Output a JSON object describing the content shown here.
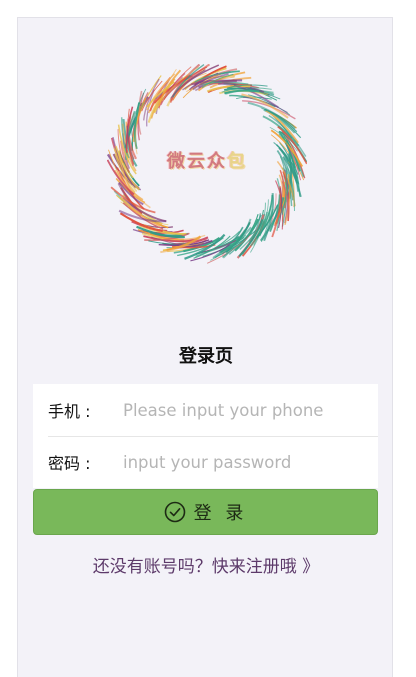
{
  "logo": {
    "text_main": "微云众",
    "text_last": "包"
  },
  "page_title": "登录页",
  "form": {
    "phone_label": "手机 :",
    "phone_placeholder": "Please input your phone",
    "password_label": "密码 :",
    "password_placeholder": "input your password"
  },
  "login_button": {
    "label": "登 录",
    "icon": "check-circle-icon"
  },
  "register_link": "还没有账号吗？快来注册哦 》",
  "colors": {
    "background": "#f3f2f8",
    "button": "#79b85a",
    "link": "#5d3a6a"
  }
}
